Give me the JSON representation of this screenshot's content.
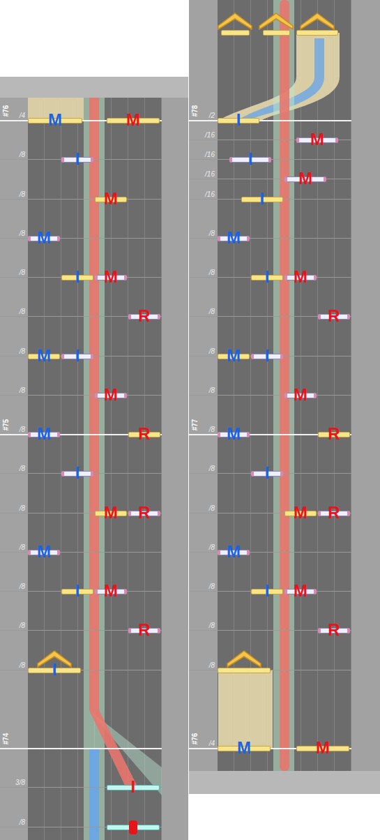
{
  "panels": [
    {
      "gridlines": [
        {
          "pos": 16,
          "label": "/4",
          "measure": "#76"
        },
        {
          "pos": 15,
          "label": "/8",
          "measure": ""
        },
        {
          "pos": 14,
          "label": "/8",
          "measure": ""
        },
        {
          "pos": 13,
          "label": "/8",
          "measure": ""
        },
        {
          "pos": 12,
          "label": "/8",
          "measure": ""
        },
        {
          "pos": 11,
          "label": "/8",
          "measure": ""
        },
        {
          "pos": 10,
          "label": "/8",
          "measure": ""
        },
        {
          "pos": 9,
          "label": "/8",
          "measure": ""
        },
        {
          "pos": 8,
          "label": "/8",
          "measure": "#75"
        },
        {
          "pos": 7,
          "label": "/8",
          "measure": ""
        },
        {
          "pos": 6,
          "label": "/8",
          "measure": ""
        },
        {
          "pos": 5,
          "label": "/8",
          "measure": ""
        },
        {
          "pos": 4,
          "label": "/8",
          "measure": ""
        },
        {
          "pos": 3,
          "label": "/8",
          "measure": ""
        },
        {
          "pos": 2,
          "label": "/8",
          "measure": ""
        },
        {
          "pos": 0,
          "label": "",
          "measure": "#74"
        },
        {
          "pos": -1,
          "label": "3/8",
          "measure": ""
        },
        {
          "pos": -2,
          "label": "/8",
          "measure": ""
        }
      ],
      "notes": [
        {
          "pos": 16,
          "lane": 0,
          "span": 1.67,
          "kind": "tap",
          "finger": "M",
          "color": "#1a62e6"
        },
        {
          "pos": 16,
          "lane": 2.35,
          "span": 1.63,
          "kind": "tap",
          "finger": "M",
          "color": "#e8141b"
        },
        {
          "pos": 15,
          "lane": 1,
          "span": 1,
          "kind": "note",
          "finger": "I",
          "color": "#1a62e6"
        },
        {
          "pos": 14,
          "lane": 2,
          "span": 1,
          "kind": "tap",
          "finger": "M",
          "color": "#e8141b"
        },
        {
          "pos": 13,
          "lane": 0,
          "span": 1,
          "kind": "note",
          "finger": "M",
          "color": "#1a62e6"
        },
        {
          "pos": 12,
          "lane": 1,
          "span": 1,
          "kind": "tap",
          "finger": "I",
          "color": "#1a62e6"
        },
        {
          "pos": 12,
          "lane": 2,
          "span": 1,
          "kind": "note",
          "finger": "M",
          "color": "#e8141b"
        },
        {
          "pos": 11,
          "lane": 3,
          "span": 1,
          "kind": "note",
          "finger": "R",
          "color": "#e8141b"
        },
        {
          "pos": 10,
          "lane": 0,
          "span": 1,
          "kind": "tap",
          "finger": "M",
          "color": "#1a62e6"
        },
        {
          "pos": 10,
          "lane": 1,
          "span": 1,
          "kind": "note",
          "finger": "I",
          "color": "#1a62e6"
        },
        {
          "pos": 9,
          "lane": 2,
          "span": 1,
          "kind": "note",
          "finger": "M",
          "color": "#e8141b"
        },
        {
          "pos": 8,
          "lane": 0,
          "span": 1,
          "kind": "note",
          "finger": "M",
          "color": "#1a62e6"
        },
        {
          "pos": 8,
          "lane": 3,
          "span": 1,
          "kind": "tap",
          "finger": "R",
          "color": "#e8141b"
        },
        {
          "pos": 7,
          "lane": 1,
          "span": 1,
          "kind": "note",
          "finger": "I",
          "color": "#1a62e6"
        },
        {
          "pos": 6,
          "lane": 2,
          "span": 1,
          "kind": "tap",
          "finger": "M",
          "color": "#e8141b"
        },
        {
          "pos": 6,
          "lane": 3,
          "span": 1,
          "kind": "note",
          "finger": "R",
          "color": "#e8141b"
        },
        {
          "pos": 5,
          "lane": 0,
          "span": 1,
          "kind": "note",
          "finger": "M",
          "color": "#1a62e6"
        },
        {
          "pos": 4,
          "lane": 1,
          "span": 1,
          "kind": "tap",
          "finger": "I",
          "color": "#1a62e6"
        },
        {
          "pos": 4,
          "lane": 2,
          "span": 1,
          "kind": "note",
          "finger": "M",
          "color": "#e8141b"
        },
        {
          "pos": 3,
          "lane": 3,
          "span": 1,
          "kind": "note",
          "finger": "R",
          "color": "#e8141b"
        },
        {
          "pos": 2,
          "lane": 0,
          "span": 1.63,
          "kind": "flick",
          "finger": "I",
          "color": "#1a62e6"
        },
        {
          "pos": -1,
          "lane": 2.35,
          "span": 1.63,
          "kind": "slide",
          "finger": "I",
          "color": "#e8141b"
        },
        {
          "pos": -2,
          "lane": 2.35,
          "span": 1.63,
          "kind": "slide-end",
          "finger": "",
          "color": "#e8141b"
        }
      ]
    },
    {
      "gridlines": [
        {
          "pos": 16,
          "label": "/2",
          "measure": "#78"
        },
        {
          "pos": 15.5,
          "label": "/16",
          "measure": ""
        },
        {
          "pos": 15,
          "label": "/16",
          "measure": ""
        },
        {
          "pos": 14.5,
          "label": "/16",
          "measure": ""
        },
        {
          "pos": 14,
          "label": "/16",
          "measure": ""
        },
        {
          "pos": 13,
          "label": "/8",
          "measure": ""
        },
        {
          "pos": 12,
          "label": "/8",
          "measure": ""
        },
        {
          "pos": 11,
          "label": "/8",
          "measure": ""
        },
        {
          "pos": 10,
          "label": "/8",
          "measure": ""
        },
        {
          "pos": 9,
          "label": "/8",
          "measure": ""
        },
        {
          "pos": 8,
          "label": "/8",
          "measure": "#77"
        },
        {
          "pos": 7,
          "label": "/8",
          "measure": ""
        },
        {
          "pos": 6,
          "label": "/8",
          "measure": ""
        },
        {
          "pos": 5,
          "label": "/8",
          "measure": ""
        },
        {
          "pos": 4,
          "label": "/8",
          "measure": ""
        },
        {
          "pos": 3,
          "label": "/8",
          "measure": ""
        },
        {
          "pos": 2,
          "label": "/8",
          "measure": ""
        },
        {
          "pos": 0,
          "label": "/4",
          "measure": "#76"
        }
      ],
      "notes": [
        {
          "pos": 18.24,
          "lane": 0.1,
          "span": 0.9,
          "kind": "flick",
          "finger": "",
          "color": ""
        },
        {
          "pos": 18.24,
          "lane": 1.35,
          "span": 0.85,
          "kind": "flick",
          "finger": "",
          "color": ""
        },
        {
          "pos": 18.24,
          "lane": 2.35,
          "span": 1.3,
          "kind": "flick",
          "finger": "",
          "color": ""
        },
        {
          "pos": 16,
          "lane": 0,
          "span": 1.3,
          "kind": "tap",
          "finger": "I",
          "color": "#1a62e6"
        },
        {
          "pos": 15.5,
          "lane": 2.35,
          "span": 1.3,
          "kind": "note",
          "finger": "M",
          "color": "#e8141b"
        },
        {
          "pos": 15,
          "lane": 0.35,
          "span": 1.3,
          "kind": "note",
          "finger": "I",
          "color": "#1a62e6"
        },
        {
          "pos": 14.5,
          "lane": 2,
          "span": 1.3,
          "kind": "note",
          "finger": "M",
          "color": "#e8141b"
        },
        {
          "pos": 14,
          "lane": 0.7,
          "span": 1.3,
          "kind": "tap",
          "finger": "I",
          "color": "#1a62e6"
        },
        {
          "pos": 13,
          "lane": 0,
          "span": 1,
          "kind": "note",
          "finger": "M",
          "color": "#1a62e6"
        },
        {
          "pos": 12,
          "lane": 1,
          "span": 1,
          "kind": "tap",
          "finger": "I",
          "color": "#1a62e6"
        },
        {
          "pos": 12,
          "lane": 2,
          "span": 1,
          "kind": "note",
          "finger": "M",
          "color": "#e8141b"
        },
        {
          "pos": 11,
          "lane": 3,
          "span": 1,
          "kind": "note",
          "finger": "R",
          "color": "#e8141b"
        },
        {
          "pos": 10,
          "lane": 0,
          "span": 1,
          "kind": "tap",
          "finger": "M",
          "color": "#1a62e6"
        },
        {
          "pos": 10,
          "lane": 1,
          "span": 1,
          "kind": "note",
          "finger": "I",
          "color": "#1a62e6"
        },
        {
          "pos": 9,
          "lane": 2,
          "span": 1,
          "kind": "note",
          "finger": "M",
          "color": "#e8141b"
        },
        {
          "pos": 8,
          "lane": 0,
          "span": 1,
          "kind": "note",
          "finger": "M",
          "color": "#1a62e6"
        },
        {
          "pos": 8,
          "lane": 3,
          "span": 1,
          "kind": "tap",
          "finger": "R",
          "color": "#e8141b"
        },
        {
          "pos": 7,
          "lane": 1,
          "span": 1,
          "kind": "note",
          "finger": "I",
          "color": "#1a62e6"
        },
        {
          "pos": 6,
          "lane": 2,
          "span": 1,
          "kind": "tap",
          "finger": "M",
          "color": "#e8141b"
        },
        {
          "pos": 6,
          "lane": 3,
          "span": 1,
          "kind": "note",
          "finger": "R",
          "color": "#e8141b"
        },
        {
          "pos": 5,
          "lane": 0,
          "span": 1,
          "kind": "note",
          "finger": "M",
          "color": "#1a62e6"
        },
        {
          "pos": 4,
          "lane": 1,
          "span": 1,
          "kind": "tap",
          "finger": "I",
          "color": "#1a62e6"
        },
        {
          "pos": 4,
          "lane": 2,
          "span": 1,
          "kind": "note",
          "finger": "M",
          "color": "#e8141b"
        },
        {
          "pos": 3,
          "lane": 3,
          "span": 1,
          "kind": "note",
          "finger": "R",
          "color": "#e8141b"
        },
        {
          "pos": 2,
          "lane": 0,
          "span": 1.63,
          "kind": "flick",
          "finger": "",
          "color": ""
        },
        {
          "pos": 0,
          "lane": 0,
          "span": 1.63,
          "kind": "tap",
          "finger": "M",
          "color": "#1a62e6"
        },
        {
          "pos": 0,
          "lane": 2.35,
          "span": 1.63,
          "kind": "tap",
          "finger": "M",
          "color": "#e8141b"
        }
      ]
    }
  ]
}
